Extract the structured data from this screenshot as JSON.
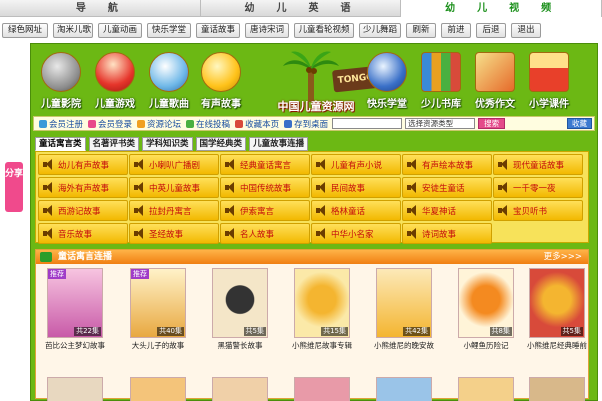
{
  "top_tabs": [
    "导　航",
    "幼　儿　英　语",
    "幼　儿　视　频"
  ],
  "toolbar": [
    "绿色网址",
    "淘米儿歌",
    "儿童动画",
    "快乐学堂",
    "童话故事",
    "唐诗宋词",
    "儿童看轮视频",
    "少儿舞蹈",
    "刷新",
    "前进",
    "后退",
    "退出"
  ],
  "icons": [
    "儿童影院",
    "儿童游戏",
    "儿童歌曲",
    "有声故事",
    "快乐学堂",
    "少儿书库",
    "优秀作文",
    "小学课件"
  ],
  "logo": {
    "title": "中国儿童资源网",
    "stamp": "TONGCI"
  },
  "linkbar": {
    "links": [
      "会员注册",
      "会员登录",
      "资源论坛",
      "在线投稿",
      "收藏本页",
      "存到桌面"
    ],
    "select": "选择资源类型",
    "search": "搜索",
    "fav": "收藏"
  },
  "cat_tabs": [
    "童话寓言类",
    "名著评书类",
    "学科知识类",
    "国学经典类",
    "儿童故事连播"
  ],
  "grid": [
    [
      "幼儿有声故事",
      "小喇叭广播剧",
      "经典童话寓言",
      "儿童有声小说",
      "有声绘本故事",
      "现代童话故事"
    ],
    [
      "海外有声故事",
      "中英儿童故事",
      "中国传统故事",
      "民间故事",
      "安徒生童话",
      "一千零一夜"
    ],
    [
      "西游记故事",
      "拉封丹寓言",
      "伊索寓言",
      "格林童话",
      "华夏神话",
      "宝贝听书"
    ],
    [
      "音乐故事",
      "圣经故事",
      "名人故事",
      "中华小名家",
      "诗词故事"
    ]
  ],
  "lower": {
    "title": "童话寓言连播",
    "more": "更多>>>"
  },
  "books": [
    {
      "name": "芭比公主梦幻故事",
      "ep": "共22集",
      "rec": "推荐"
    },
    {
      "name": "大头儿子的故事",
      "ep": "共40集",
      "rec": "推荐"
    },
    {
      "name": "黑猫警长故事",
      "ep": "共5集",
      "rec": ""
    },
    {
      "name": "小熊维尼故事专辑",
      "ep": "共15集",
      "rec": ""
    },
    {
      "name": "小熊维尼的晚安故",
      "ep": "共42集",
      "rec": ""
    },
    {
      "name": "小鲤鱼历险记",
      "ep": "共8集",
      "rec": ""
    },
    {
      "name": "小熊维尼经典睡前",
      "ep": "共5集",
      "rec": ""
    }
  ],
  "books2": [
    "",
    "",
    "",
    "",
    "",
    "",
    ""
  ],
  "share": "分享",
  "colors": {
    "panel_green": "#6cb814",
    "cell_yellow": "#f2b800",
    "story_red": "#c50c0c",
    "header_orange": "#f07f12"
  }
}
